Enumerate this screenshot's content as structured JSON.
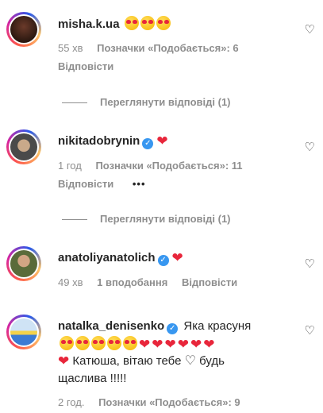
{
  "comments": [
    {
      "username": "misha.k.ua",
      "time": "55 хв",
      "likes": "Позначки «Подобається»: 6",
      "reply": "Відповісти",
      "view_replies": "Переглянути відповіді (1)",
      "emoji_icon": "heart-eyes-emoji",
      "emoji_count": 3
    },
    {
      "username": "nikitadobrynin",
      "time": "1 год",
      "likes": "Позначки «Подобається»: 11",
      "reply": "Відповісти",
      "more": "•••",
      "view_replies": "Переглянути відповіді (1)",
      "verified": true,
      "reaction_icon": "red-heart-emoji"
    },
    {
      "username": "anatoliyanatolich",
      "time": "49 хв",
      "likes": "1 вподобання",
      "reply": "Відповісти",
      "verified": true,
      "reaction_icon": "red-heart-emoji"
    },
    {
      "username": "natalka_denisenko",
      "text_start": "Яка красуня",
      "text_middle": "Катюша, вітаю тебе",
      "text_end": "будь",
      "text_last": "щаслива !!!!!",
      "time": "2 год.",
      "likes": "Позначки «Подобається»: 9",
      "verified": true
    }
  ],
  "colors": {
    "text": "#262626",
    "secondary": "#8e8e8e",
    "verified_blue": "#3897f0",
    "heart_red": "#e8263b"
  }
}
